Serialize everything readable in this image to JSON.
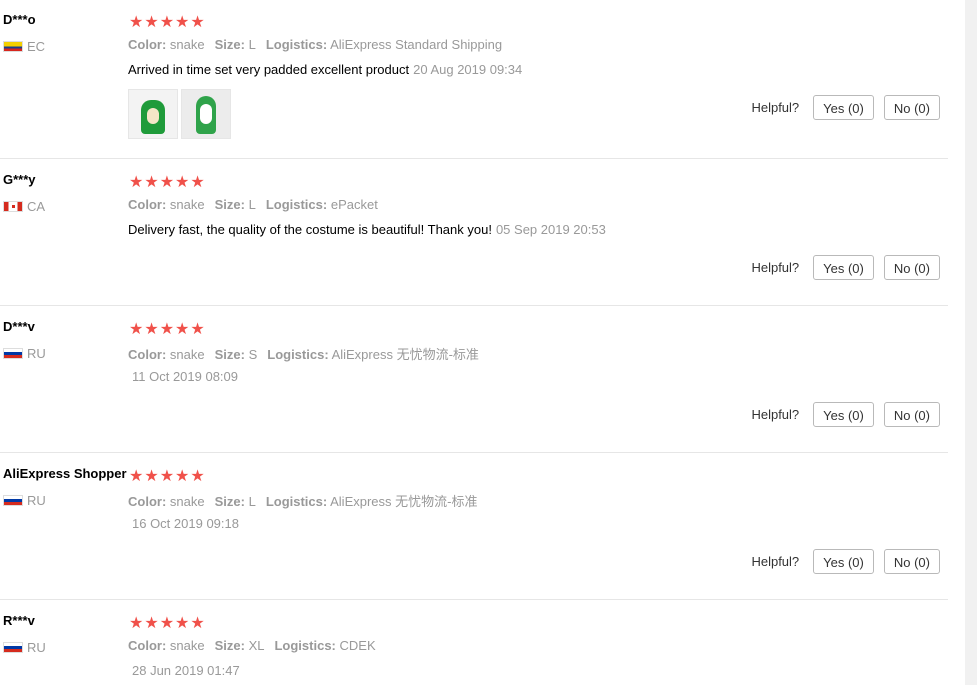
{
  "labels": {
    "color": "Color:",
    "size": "Size:",
    "logistics": "Logistics:",
    "helpful": "Helpful?",
    "stars": "★★★★★"
  },
  "reviews": [
    {
      "user": "D***o",
      "country": "EC",
      "flag": "flag-ec",
      "rating": 5,
      "color": "snake",
      "size": "L",
      "logistics": "AliExpress Standard Shipping",
      "text": "Arrived in time set very padded excellent product",
      "date": "20 Aug 2019 09:34",
      "yes": "Yes (0)",
      "no": "No (0)",
      "has_photos": true
    },
    {
      "user": "G***y",
      "country": "CA",
      "flag": "flag-ca",
      "rating": 5,
      "color": "snake",
      "size": "L",
      "logistics": "ePacket",
      "text": "Delivery fast, the quality of the costume is beautiful! Thank you!",
      "date": "05 Sep 2019 20:53",
      "yes": "Yes (0)",
      "no": "No (0)"
    },
    {
      "user": "D***v",
      "country": "RU",
      "flag": "flag-ru",
      "rating": 5,
      "color": "snake",
      "size": "S",
      "logistics": "AliExpress 无忧物流-标准",
      "text": "",
      "date": "11 Oct 2019 08:09",
      "yes": "Yes (0)",
      "no": "No (0)"
    },
    {
      "user": "AliExpress Shopper",
      "country": "RU",
      "flag": "flag-ru",
      "rating": 5,
      "color": "snake",
      "size": "L",
      "logistics": "AliExpress 无忧物流-标准",
      "text": "",
      "date": "16 Oct 2019 09:18",
      "yes": "Yes (0)",
      "no": "No (0)"
    },
    {
      "user": "R***v",
      "country": "RU",
      "flag": "flag-ru",
      "rating": 5,
      "color": "snake",
      "size": "XL",
      "logistics": "CDEK",
      "text": "",
      "date": "28 Jun 2019 01:47",
      "yes": "Yes (0)",
      "no": "No (0)"
    }
  ]
}
